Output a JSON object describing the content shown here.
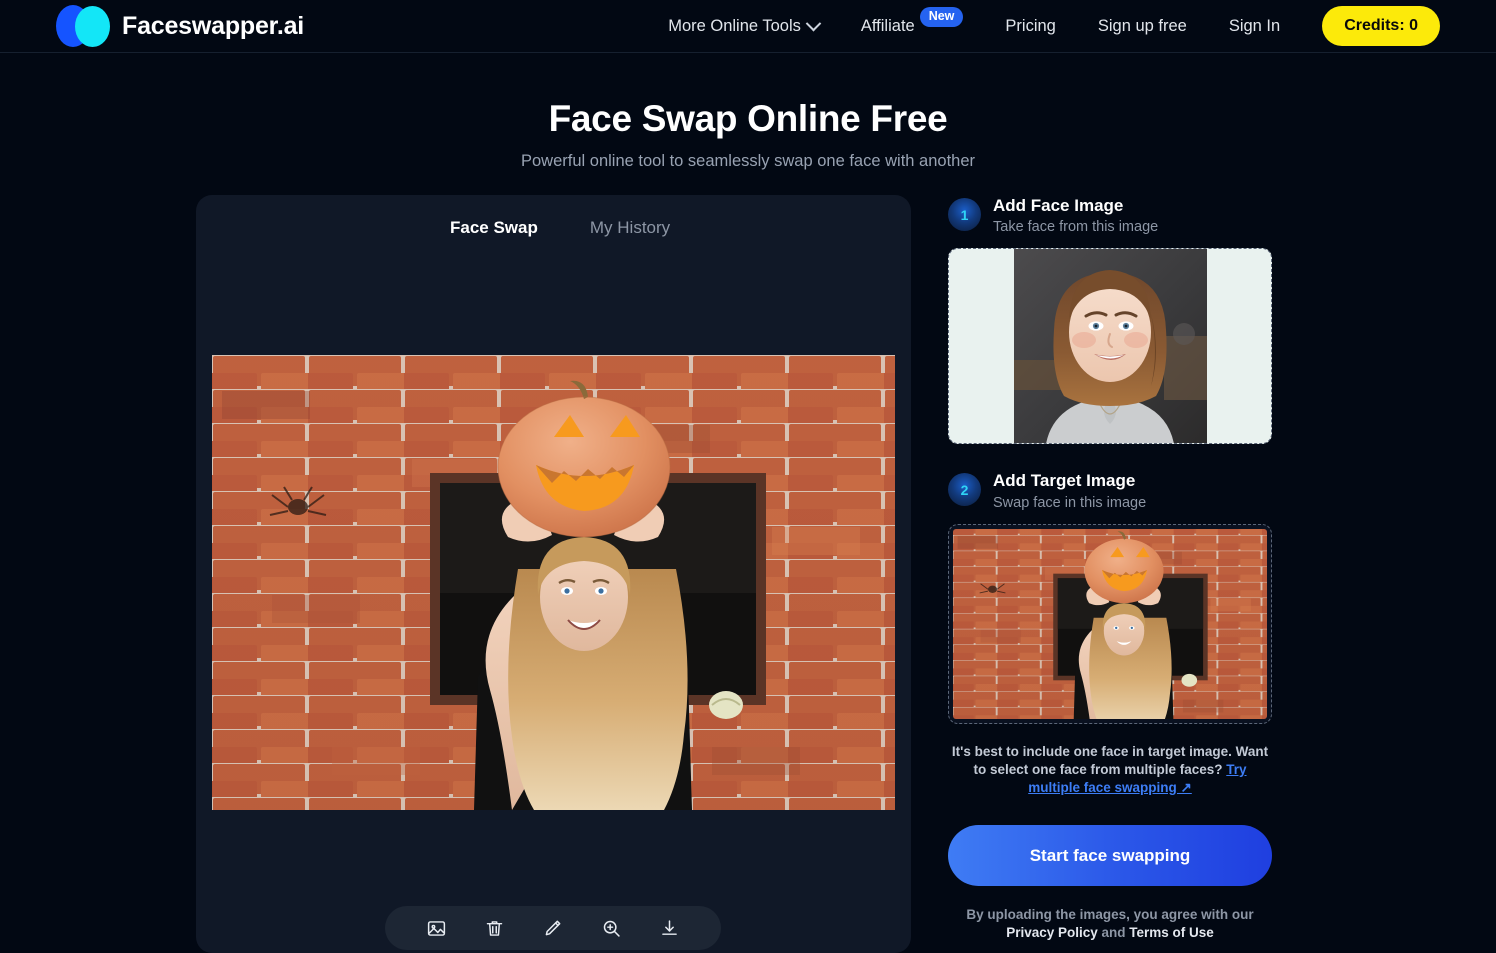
{
  "header": {
    "brand_name": "Faceswapper.ai",
    "logo_icon": "two-overlapping-circles-logo",
    "nav": [
      {
        "label": "More Online Tools",
        "icon": "chevron-down-icon",
        "badge": null
      },
      {
        "label": "Affiliate",
        "icon": null,
        "badge": "New"
      },
      {
        "label": "Pricing",
        "icon": null,
        "badge": null
      },
      {
        "label": "Sign up free",
        "icon": null,
        "badge": null
      },
      {
        "label": "Sign In",
        "icon": null,
        "badge": null
      }
    ],
    "credits_label": "Credits: 0",
    "credits_color": "#fcea0a"
  },
  "hero": {
    "title": "Face Swap Online Free",
    "subtitle": "Powerful online tool to seamlessly swap one face with another"
  },
  "tabs": [
    {
      "label": "Face Swap",
      "active": true
    },
    {
      "label": "My History",
      "active": false
    }
  ],
  "toolbar": {
    "buttons": [
      {
        "name": "image-icon",
        "label": "Image"
      },
      {
        "name": "trash-icon",
        "label": "Delete"
      },
      {
        "name": "pencil-icon",
        "label": "Edit"
      },
      {
        "name": "zoom-in-icon",
        "label": "Zoom in"
      },
      {
        "name": "download-icon",
        "label": "Download"
      }
    ]
  },
  "side": {
    "steps": [
      {
        "number": "1",
        "title": "Add Face Image",
        "subtitle": "Take face from this image",
        "dropzone_name": "face-image-dropzone"
      },
      {
        "number": "2",
        "title": "Add Target Image",
        "subtitle": "Swap face in this image",
        "dropzone_name": "target-image-dropzone"
      }
    ],
    "hint_text": "It's best to include one face in target image. Want to select one face from multiple faces? ",
    "hint_link": "Try multiple face swapping ↗",
    "cta_label": "Start face swapping",
    "cta_color": "#2a56e8",
    "legal_prefix": "By uploading the images, you agree with our ",
    "legal_privacy": "Privacy Policy",
    "legal_middle": " and ",
    "legal_terms": "Terms of Use"
  }
}
